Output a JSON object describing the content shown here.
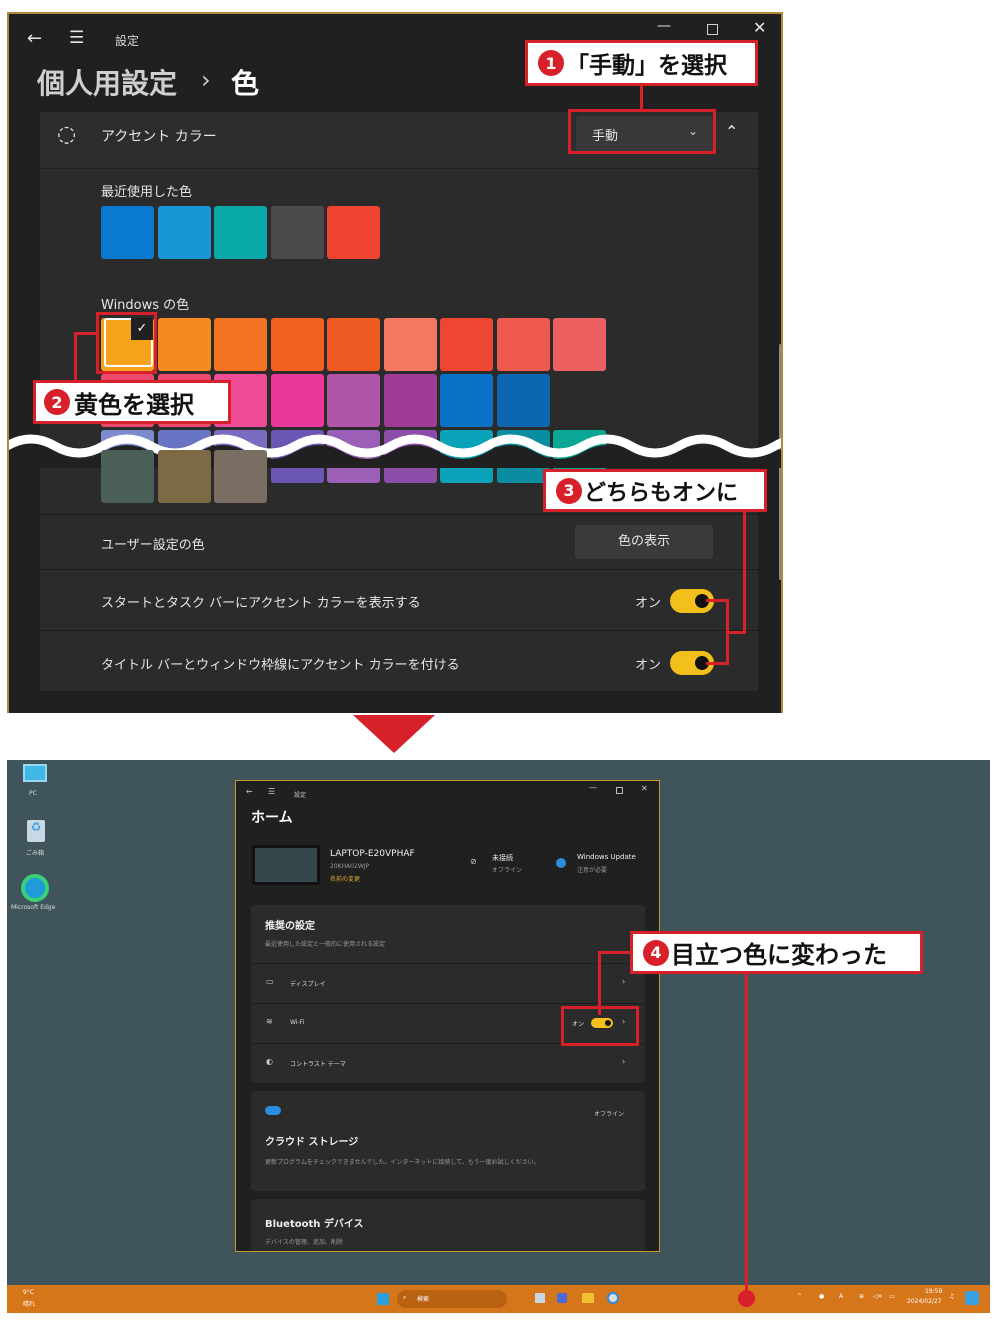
{
  "top": {
    "window_title": "設定",
    "breadcrumb_parent": "個人用設定",
    "breadcrumb_sep": "›",
    "breadcrumb_current": "色",
    "accent_label": "アクセント カラー",
    "accent_dropdown_value": "手動",
    "recent_label": "最近使用した色",
    "recent_colors": [
      "#0a7ad0",
      "#1996d6",
      "#08a9a8",
      "#4b4b4b",
      "#ee4430"
    ],
    "windows_label": "Windows の色",
    "windows_row1": [
      "#f7a21b",
      "#f58a20",
      "#f27324",
      "#f26122",
      "#ef5a23",
      "#f37a5e",
      "#ef4535",
      "#ee5a4e",
      "#ee5f62"
    ],
    "windows_row2": [
      "#ef4a6d",
      "#ef4a6d",
      "#ee4c97",
      "#e9389a",
      "#b055aa",
      "#9d3b96",
      "#0a72c6",
      "#0c66b0"
    ],
    "windows_row3": [
      "#7c8bcf",
      "#6a74c4",
      "#7b6cc2",
      "#6c56b4",
      "#9b5fb8",
      "#8a4ea8",
      "#0aa2b8",
      "#0a8da0",
      "#0aa894"
    ],
    "windows_row4": [
      "#4a5f56",
      "#7c6a45",
      "#7a6e63"
    ],
    "custom_label": "ユーザー設定の色",
    "custom_button": "色の表示",
    "start_label": "スタートとタスク バーにアクセント カラーを表示する",
    "title_label": "タイトル バーとウィンドウ枠線にアクセント カラーを付ける",
    "toggle_on": "オン"
  },
  "callouts": {
    "c1_num": "1",
    "c1_text": "「手動」を選択",
    "c2_num": "2",
    "c2_text": "黄色を選択",
    "c3_num": "3",
    "c3_text": "どちらもオンに",
    "c4_num": "4",
    "c4_text": "目立つ色に変わった"
  },
  "desktop": {
    "icon_pc": "PC",
    "icon_recycle": "ごみ箱",
    "icon_edge": "Microsoft Edge",
    "mini_title": "設定",
    "home": "ホーム",
    "device_name": "LAPTOP-E20VPHAF",
    "device_model": "20KHA02WJP",
    "rename": "名前の変更",
    "net_status": "未接続",
    "net_sub": "オフライン",
    "wu_title": "Windows Update",
    "wu_sub": "注意が必要",
    "rec_title": "推奨の設定",
    "rec_sub": "最近使用した設定と一般的に使用される設定",
    "display": "ディスプレイ",
    "wifi": "Wi-Fi",
    "wifi_state": "オン",
    "contrast": "コントラスト テーマ",
    "cloud_status": "オフライン",
    "cloud_title": "クラウド ストレージ",
    "cloud_sub": "更新プログラムをチェックできませんでした。インターネットに接続して、もう一度お試しください。",
    "bt_title": "Bluetooth デバイス",
    "bt_sub": "デバイスの管理、追加、削除",
    "weather_temp": "9°C",
    "weather_desc": "晴れ",
    "search_placeholder": "検索",
    "clock_time": "19:59",
    "clock_date": "2024/02/27"
  },
  "colors": {
    "accent_yellow": "#f3c01b",
    "callout_red": "#d8202a",
    "taskbar": "#d6761a"
  }
}
